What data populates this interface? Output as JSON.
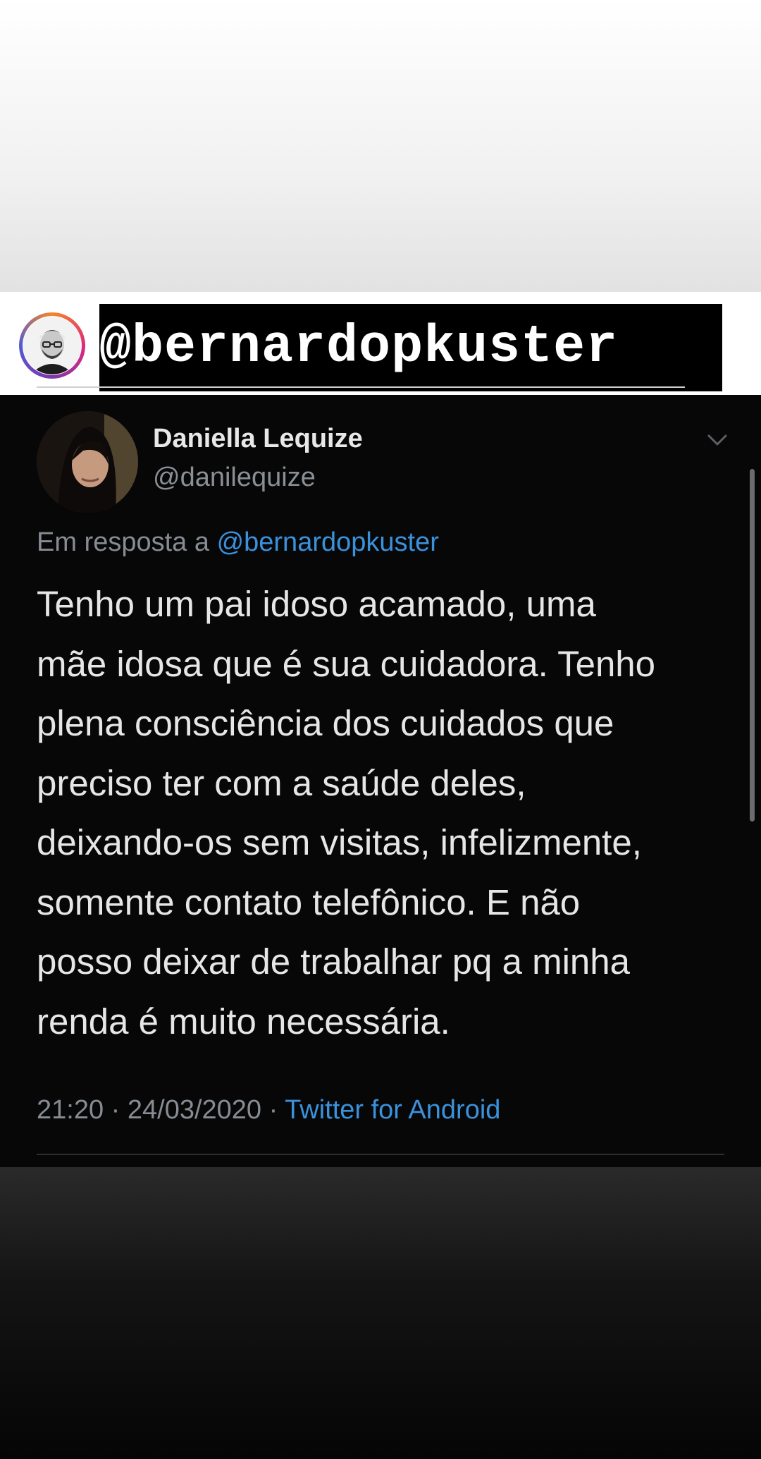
{
  "story": {
    "mention_sticker": "@bernardopkuster",
    "avatar_icon": "profile-photo-icon"
  },
  "tweet": {
    "author_name": "Daniella Lequize",
    "author_handle": "@danilequize",
    "reply_prefix": "Em resposta a",
    "reply_handle": "@bernardopkuster",
    "body_lines": [
      "Tenho um pai idoso acamado, uma",
      "mãe idosa que é sua cuidadora. Tenho",
      "plena consciência dos cuidados que",
      "preciso ter com a saúde deles,",
      "deixando-os sem visitas, infelizmente,",
      "somente contato telefônico. E não",
      "posso deixar de trabalhar pq a minha",
      "renda é muito necessária."
    ],
    "time": "21:20",
    "separator": "·",
    "date": "24/03/2020",
    "source": "Twitter for Android",
    "colors": {
      "link": "#3a91dc",
      "text": "#e6e6e6",
      "muted": "#878c92",
      "background": "#070708"
    }
  }
}
